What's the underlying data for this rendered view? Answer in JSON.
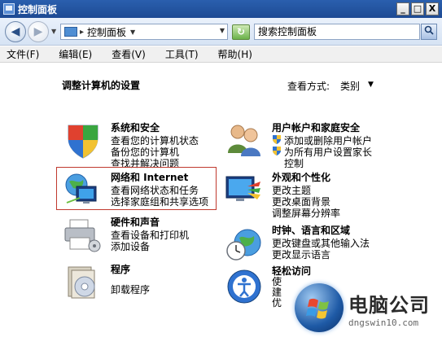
{
  "window": {
    "title": "控制面板"
  },
  "title_buttons": {
    "minimize": "_",
    "maximize": "□",
    "close": "X"
  },
  "address": {
    "crumb": "控制面板",
    "search_placeholder": "搜索控制面板"
  },
  "menu": [
    "文件(F)",
    "编辑(E)",
    "查看(V)",
    "工具(T)",
    "帮助(H)"
  ],
  "main": {
    "heading": "调整计算机的设置",
    "view_by_label": "查看方式:",
    "view_by_value": "类别"
  },
  "categories": {
    "system": {
      "title": "系统和安全",
      "links": [
        "查看您的计算机状态",
        "备份您的计算机",
        "查找并解决问题"
      ]
    },
    "network": {
      "title": "网络和 Internet",
      "links": [
        "查看网络状态和任务",
        "选择家庭组和共享选项"
      ]
    },
    "hardware": {
      "title": "硬件和声音",
      "links": [
        "查看设备和打印机",
        "添加设备"
      ]
    },
    "programs": {
      "title": "程序",
      "links": [
        "卸载程序"
      ]
    },
    "users": {
      "title": "用户帐户和家庭安全",
      "links": [
        "添加或删除用户帐户",
        "为所有用户设置家长",
        "控制"
      ]
    },
    "appearance": {
      "title": "外观和个性化",
      "links": [
        "更改主题",
        "更改桌面背景",
        "调整屏幕分辨率"
      ]
    },
    "clock": {
      "title": "时钟、语言和区域",
      "links": [
        "更改键盘或其他输入法",
        "更改显示语言"
      ]
    },
    "access": {
      "title": "轻松访问",
      "links": [
        "使",
        "建",
        "优"
      ]
    }
  },
  "watermark": {
    "title": "电脑公司",
    "subtitle": "dngswin10.com"
  },
  "colors": {
    "titlebar": "#1d4a93",
    "highlight_border": "#c03a2e"
  }
}
